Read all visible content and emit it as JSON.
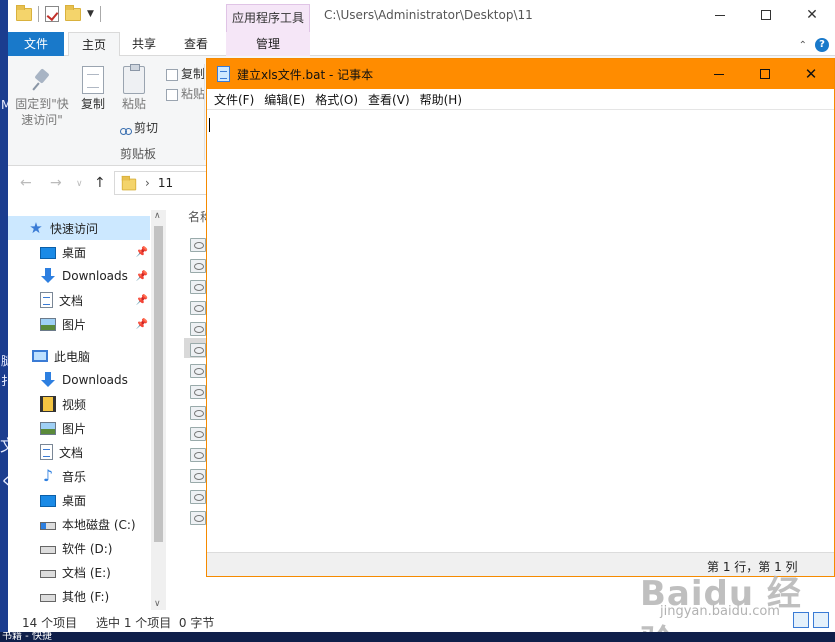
{
  "desktop": {
    "frag_1": "M",
    "frag_2": "腿",
    "frag_3": "扌",
    "frag_4": "文",
    "frag_5": "く",
    "taskbar_text": "书籍 - 快捷"
  },
  "explorer": {
    "contextual_tab_title": "应用程序工具",
    "window_path": "C:\\Users\\Administrator\\Desktop\\11",
    "tabs": [
      {
        "label": "文件"
      },
      {
        "label": "主页"
      },
      {
        "label": "共享"
      },
      {
        "label": "查看"
      },
      {
        "label": "管理"
      }
    ],
    "ribbon": {
      "pin_label": "固定到\"快\n速访问\"",
      "copy_label": "复制",
      "paste_label": "粘贴",
      "copy_path_label": "复制",
      "paste_shortcut_label": "粘贴",
      "cut_label": "剪切",
      "clipboard_group": "剪贴板"
    },
    "address": {
      "current": "11"
    },
    "nav_pane": {
      "items": [
        {
          "label": "快速访问"
        },
        {
          "label": "桌面"
        },
        {
          "label": "Downloads"
        },
        {
          "label": "文档"
        },
        {
          "label": "图片"
        },
        {
          "label": "此电脑"
        },
        {
          "label": "Downloads"
        },
        {
          "label": "视频"
        },
        {
          "label": "图片"
        },
        {
          "label": "文档"
        },
        {
          "label": "音乐"
        },
        {
          "label": "桌面"
        },
        {
          "label": "本地磁盘 (C:)"
        },
        {
          "label": "软件 (D:)"
        },
        {
          "label": "文档 (E:)"
        },
        {
          "label": "其他 (F:)"
        }
      ]
    },
    "file_list": {
      "column_name": "名称"
    },
    "status": {
      "item_count": "14 个项目",
      "selection": "选中 1 个项目  0 字节"
    }
  },
  "notepad": {
    "title": "建立xls文件.bat - 记事本",
    "menu": [
      {
        "label": "文件(F)"
      },
      {
        "label": "编辑(E)"
      },
      {
        "label": "格式(O)"
      },
      {
        "label": "查看(V)"
      },
      {
        "label": "帮助(H)"
      }
    ],
    "content": "",
    "status_position": "第 1 行，第 1 列"
  },
  "watermark": {
    "logo": "Baidu 经验",
    "url": "jingyan.baidu.com"
  }
}
